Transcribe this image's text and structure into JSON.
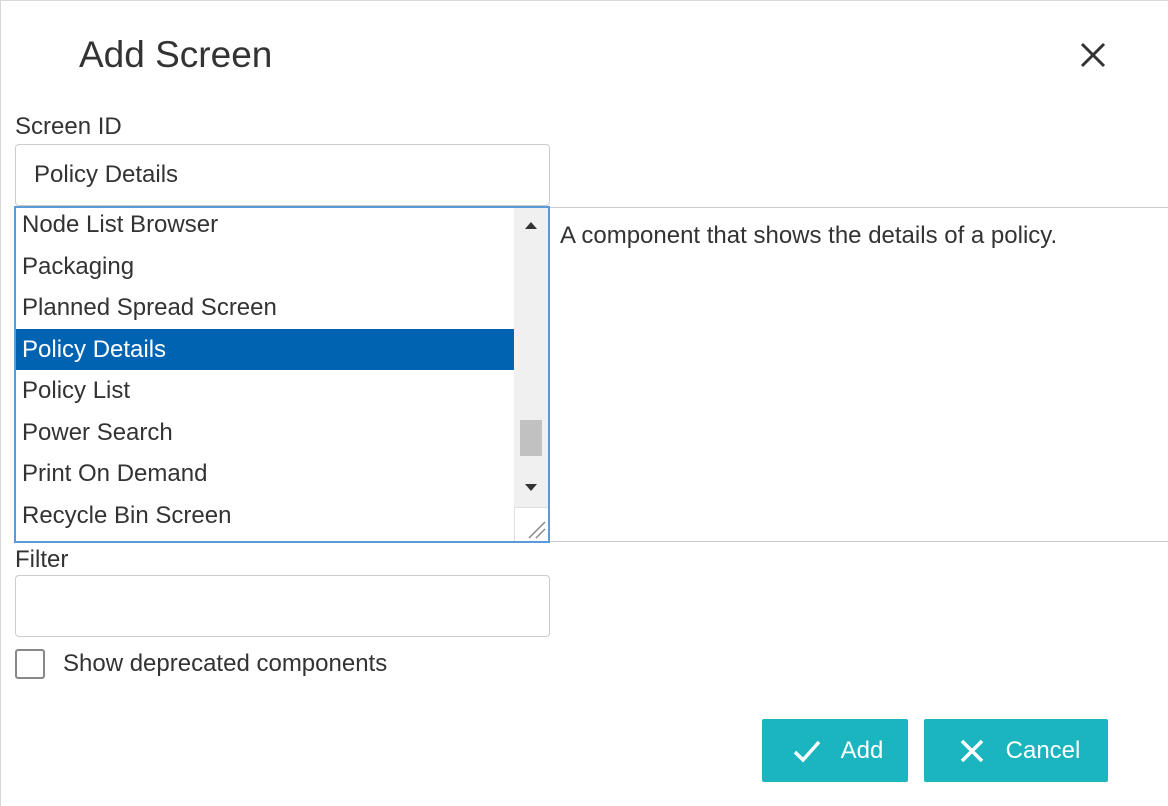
{
  "dialog": {
    "title": "Add Screen",
    "close_icon": "close-icon"
  },
  "screen_id": {
    "label": "Screen ID",
    "value": "Policy Details"
  },
  "component_list": {
    "items": [
      "Node List Browser",
      "Packaging",
      "Planned Spread Screen",
      "Policy Details",
      "Policy List",
      "Power Search",
      "Print On Demand",
      "Recycle Bin Screen"
    ],
    "selected": "Policy Details",
    "scroll_position": 0.72
  },
  "description": {
    "text": "A component that shows the details of a policy."
  },
  "filter": {
    "label": "Filter",
    "value": ""
  },
  "options": {
    "show_deprecated_label": "Show deprecated components",
    "show_deprecated_checked": false
  },
  "buttons": {
    "add_label": "Add",
    "add_icon": "checkmark-icon",
    "cancel_label": "Cancel",
    "cancel_icon": "x-icon"
  },
  "colors": {
    "accent": "#1ab5be",
    "selection": "#0063b1",
    "focus_border": "#5b9bd5"
  }
}
